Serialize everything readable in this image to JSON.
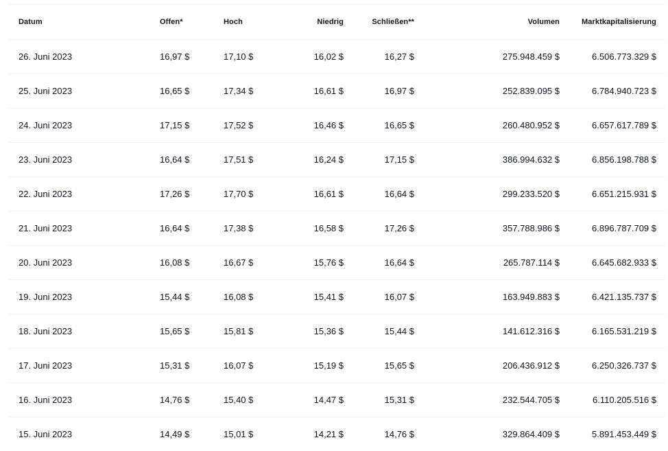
{
  "table": {
    "headers": {
      "date": "Datum",
      "open": "Offen*",
      "high": "Hoch",
      "low": "Niedrig",
      "close": "Schließen**",
      "volume": "Volumen",
      "market_cap": "Marktkapitalisierung"
    },
    "rows": [
      {
        "date": "26. Juni 2023",
        "open": "16,97 $",
        "high": "17,10 $",
        "low": "16,02 $",
        "close": "16,27 $",
        "volume": "275.948.459 $",
        "market_cap": "6.506.773.329 $"
      },
      {
        "date": "25. Juni 2023",
        "open": "16,65 $",
        "high": "17,34 $",
        "low": "16,61 $",
        "close": "16,97 $",
        "volume": "252.839.095 $",
        "market_cap": "6.784.940.723 $"
      },
      {
        "date": "24. Juni 2023",
        "open": "17,15 $",
        "high": "17,52 $",
        "low": "16,46 $",
        "close": "16,65 $",
        "volume": "260.480.952 $",
        "market_cap": "6.657.617.789 $"
      },
      {
        "date": "23. Juni 2023",
        "open": "16,64 $",
        "high": "17,51 $",
        "low": "16,24 $",
        "close": "17,15 $",
        "volume": "386.994.632 $",
        "market_cap": "6.856.198.788 $"
      },
      {
        "date": "22. Juni 2023",
        "open": "17,26 $",
        "high": "17,70 $",
        "low": "16,61 $",
        "close": "16,64 $",
        "volume": "299.233.520 $",
        "market_cap": "6.651.215.931 $"
      },
      {
        "date": "21. Juni 2023",
        "open": "16,64 $",
        "high": "17,38 $",
        "low": "16,58 $",
        "close": "17,26 $",
        "volume": "357.788.986 $",
        "market_cap": "6.896.787.709 $"
      },
      {
        "date": "20. Juni 2023",
        "open": "16,08 $",
        "high": "16,67 $",
        "low": "15,76 $",
        "close": "16,64 $",
        "volume": "265.787.114 $",
        "market_cap": "6.645.682.933 $"
      },
      {
        "date": "19. Juni 2023",
        "open": "15,44 $",
        "high": "16,08 $",
        "low": "15,41 $",
        "close": "16,07 $",
        "volume": "163.949.883 $",
        "market_cap": "6.421.135.737 $"
      },
      {
        "date": "18. Juni 2023",
        "open": "15,65 $",
        "high": "15,81 $",
        "low": "15,36 $",
        "close": "15,44 $",
        "volume": "141.612.316 $",
        "market_cap": "6.165.531.219 $"
      },
      {
        "date": "17. Juni 2023",
        "open": "15,31 $",
        "high": "16,07 $",
        "low": "15,19 $",
        "close": "15,65 $",
        "volume": "206.436.912 $",
        "market_cap": "6.250.326.737 $"
      },
      {
        "date": "16. Juni 2023",
        "open": "14,76 $",
        "high": "15,40 $",
        "low": "14,47 $",
        "close": "15,31 $",
        "volume": "232.544.705 $",
        "market_cap": "6.110.205.516 $"
      },
      {
        "date": "15. Juni 2023",
        "open": "14,49 $",
        "high": "15,01 $",
        "low": "14,21 $",
        "close": "14,76 $",
        "volume": "329.864.409 $",
        "market_cap": "5.891.453.449 $"
      }
    ]
  }
}
